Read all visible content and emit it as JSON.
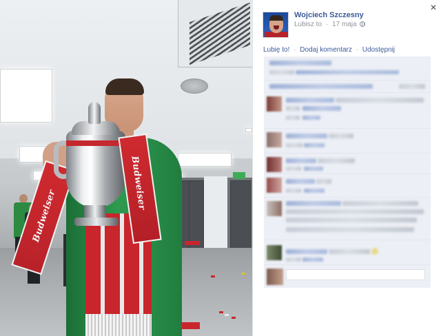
{
  "post": {
    "author_name": "Wojciech Szczesny",
    "like_label": "Lubisz to",
    "date": "17 maja",
    "privacy_icon": "globe-icon"
  },
  "actions": {
    "like": "Lubię to!",
    "comment": "Dodaj komentarz",
    "share": "Udostępnij",
    "separator": "·"
  },
  "photo": {
    "scarf_text": "Budweiser"
  },
  "colors": {
    "link": "#3b5998",
    "meta": "#90949c",
    "comments_bg": "#eceff5",
    "jersey": "#2e9a4f",
    "scarf": "#c9252c"
  }
}
